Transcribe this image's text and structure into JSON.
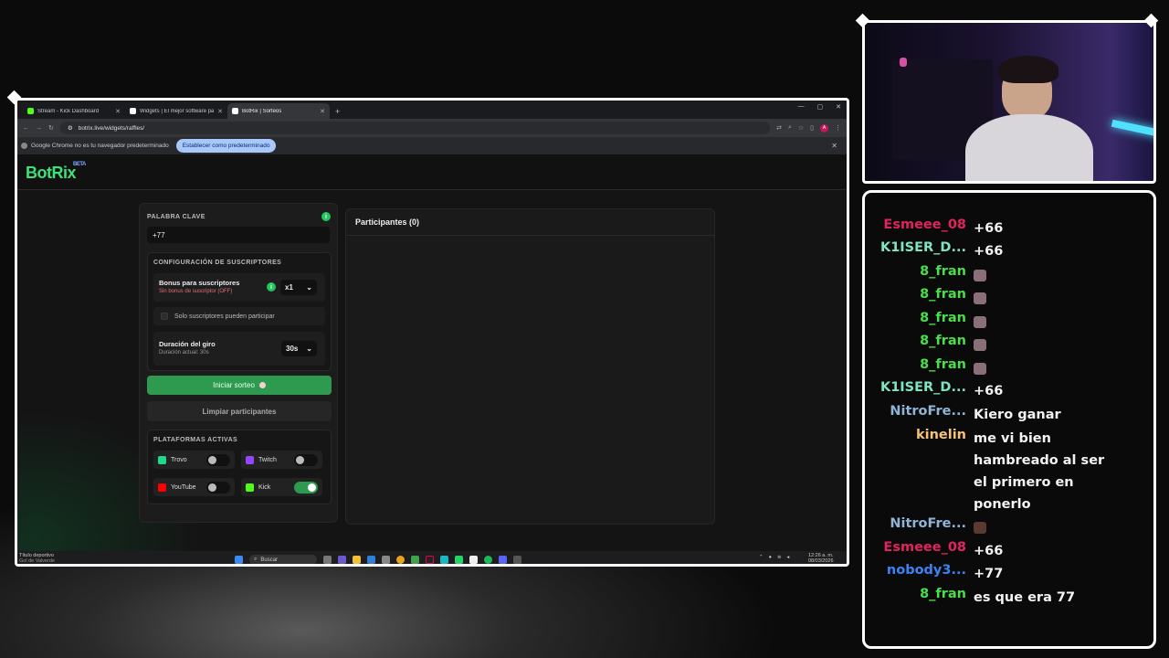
{
  "browser": {
    "tabs": [
      {
        "label": "Stream - Kick Dashboard",
        "favicon_color": "#53fc18"
      },
      {
        "label": "Widgets | El mejor software pa",
        "favicon_color": "#ffffff"
      },
      {
        "label": "BotRix | Sorteos",
        "favicon_color": "#ffffff"
      }
    ],
    "url": "botrix.live/widgets/raffles/",
    "profile_initial": "A",
    "infobar_text": "Google Chrome no es tu navegador predeterminado",
    "infobar_button": "Establecer como predeterminado"
  },
  "app": {
    "logo": "BotRix",
    "logo_badge": "BETA",
    "keyword_label": "PALABRA CLAVE",
    "keyword_value": "+77",
    "subs_section": "CONFIGURACIÓN DE SUSCRIPTORES",
    "bonus_title": "Bonus para suscriptores",
    "bonus_sub": "Sin bonus de suscriptor (OFF)",
    "bonus_value": "x1",
    "subs_only": "Solo suscriptores pueden participar",
    "duration_title": "Duración del giro",
    "duration_sub": "Duración actual: 30s",
    "duration_value": "30s",
    "start_button": "Iniciar sorteo",
    "clear_button": "Limpiar participantes",
    "platforms_section": "PLATAFORMAS ACTIVAS",
    "platforms": [
      {
        "name": "Trovo",
        "enabled": false,
        "color": "#1fd98a"
      },
      {
        "name": "Twitch",
        "enabled": false,
        "color": "#9146ff"
      },
      {
        "name": "YouTube",
        "enabled": false,
        "color": "#ff0000"
      },
      {
        "name": "Kick",
        "enabled": true,
        "color": "#53fc18"
      }
    ],
    "participants_title": "Participantes (0)"
  },
  "taskbar": {
    "weather_title": "Título deportivo",
    "weather_sub": "Gol de Valverde",
    "search": "Buscar",
    "time": "12:26 a. m.",
    "date": "08/03/2026"
  },
  "chat": [
    {
      "user": "Esmeee_08",
      "color": "#e0245e",
      "text": "+66"
    },
    {
      "user": "K1ISER_D...",
      "color": "#7fe3c4",
      "text": "+66"
    },
    {
      "user": "8_fran",
      "color": "#4ade4a",
      "text": "",
      "emote": "cat-emote"
    },
    {
      "user": "8_fran",
      "color": "#4ade4a",
      "text": "",
      "emote": "cat-emote"
    },
    {
      "user": "8_fran",
      "color": "#4ade4a",
      "text": "",
      "emote": "cat-emote"
    },
    {
      "user": "8_fran",
      "color": "#4ade4a",
      "text": "",
      "emote": "cat-emote"
    },
    {
      "user": "8_fran",
      "color": "#4ade4a",
      "text": "",
      "emote": "cat-emote"
    },
    {
      "user": "K1ISER_D...",
      "color": "#7fe3c4",
      "text": "+66"
    },
    {
      "user": "NitroFre...",
      "color": "#8fb4d6",
      "text": "Kiero ganar"
    },
    {
      "user": "kinelin",
      "color": "#f5c27a",
      "text": "me vi bien hambreado al ser el primero en ponerlo"
    },
    {
      "user": "NitroFre...",
      "color": "#8fb4d6",
      "text": "",
      "emote": "face-emote"
    },
    {
      "user": "Esmeee_08",
      "color": "#e0245e",
      "text": "+66"
    },
    {
      "user": "nobody3...",
      "color": "#3b82f6",
      "text": "+77"
    },
    {
      "user": "8_fran",
      "color": "#4ade4a",
      "text": "es que era 77"
    }
  ]
}
